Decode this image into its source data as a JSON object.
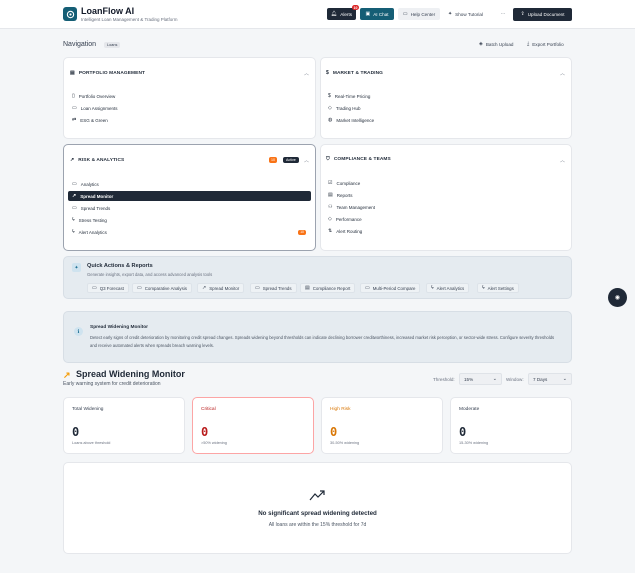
{
  "header": {
    "brand": "LoanFlow AI",
    "tagline": "Intelligent Loan Management & Trading Platform",
    "alerts_label": "Alerts",
    "alerts_count": "10",
    "ai_chat_label": "AI Chat",
    "help_label": "Help Center",
    "tutorial_label": "Show Tutorial",
    "more_label": "⋯",
    "upload_label": "Upload Document"
  },
  "nav": {
    "title": "Navigation",
    "loans_badge": "Loans",
    "batch_upload": "Batch Upload",
    "export": "Export Portfolio"
  },
  "sections": {
    "portfolio": {
      "title": "PORTFOLIO MANAGEMENT",
      "items": [
        "Portfolio Overview",
        "Loan Assignments",
        "ESG & Green"
      ]
    },
    "market": {
      "title": "MARKET & TRADING",
      "items": [
        "Real-Time Pricing",
        "Trading Hub",
        "Market Intelligence"
      ]
    },
    "risk": {
      "title": "RISK & ANALYTICS",
      "count": "10",
      "active_badge": "Active",
      "items": [
        "Analytics",
        "Spread Monitor",
        "Spread Trends",
        "Stress Testing",
        "Alert Analytics"
      ],
      "alert_count": "10"
    },
    "compliance": {
      "title": "COMPLIANCE & TEAMS",
      "items": [
        "Compliance",
        "Reports",
        "Team Management",
        "Performance",
        "Alert Routing"
      ]
    }
  },
  "quick_actions": {
    "title": "Quick Actions & Reports",
    "subtitle": "Generate insights, export data, and access advanced analysis tools",
    "chips": [
      "Q3 Forecast",
      "Comparative Analysis",
      "Spread Monitor",
      "Spread Trends",
      "Compliance Report",
      "Multi-Period Compare",
      "Alert Analytics",
      "Alert Settings"
    ]
  },
  "info": {
    "title": "Spread Widening Monitor",
    "text": "Detect early signs of credit deterioration by monitoring credit spread changes. Spreads widening beyond thresholds can indicate declining borrower creditworthiness, increased market risk perception, or sector-wide stress. Configure severity thresholds and receive automated alerts when spreads breach warning levels."
  },
  "monitor": {
    "title": "Spread Widening Monitor",
    "subtitle": "Early warning system for credit deterioration",
    "threshold_label": "Threshold:",
    "threshold_value": "15%",
    "window_label": "Window:",
    "window_value": "7 Days"
  },
  "stats": [
    {
      "label": "Total Widening",
      "value": "0",
      "sub": "Loans above threshold"
    },
    {
      "label": "Critical",
      "value": "0",
      "sub": ">50% widening"
    },
    {
      "label": "High Risk",
      "value": "0",
      "sub": "30-50% widening"
    },
    {
      "label": "Moderate",
      "value": "0",
      "sub": "15-30% widening"
    }
  ],
  "empty": {
    "title": "No significant spread widening detected",
    "subtitle": "All loans are within the 15% threshold for 7d"
  },
  "colors": {
    "accent": "#155e75",
    "dark": "#1f2937",
    "critical": "#b91c1c",
    "high": "#d97706",
    "moderate": "#374151",
    "warning_icon": "#f59e0b"
  }
}
